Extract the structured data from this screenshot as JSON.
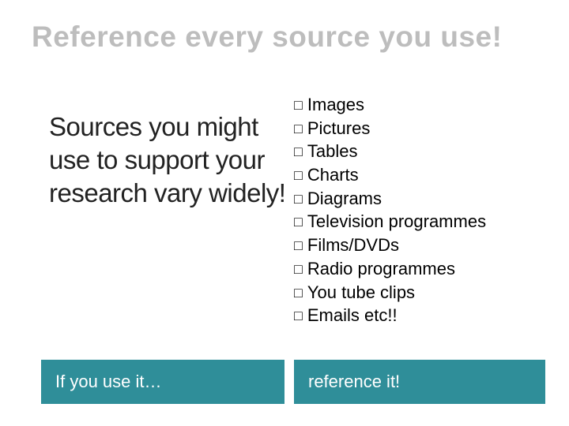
{
  "title": "Reference every source you use!",
  "subtitle": "Sources you might use to support your research vary widely!",
  "bullets": [
    "Images",
    "Pictures",
    "Tables",
    "Charts",
    "Diagrams",
    "Television programmes",
    "Films/DVDs",
    "Radio programmes",
    "You tube clips",
    "Emails etc!!"
  ],
  "footer": {
    "left": "If you use it…",
    "right": "reference it!"
  }
}
